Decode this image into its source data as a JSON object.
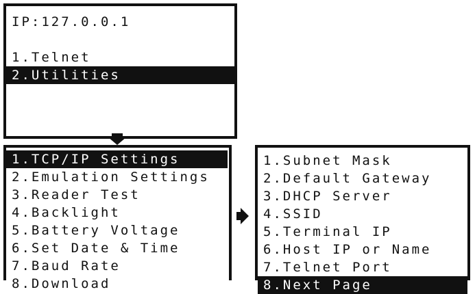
{
  "screen1": {
    "ip_label": "IP:127.0.0.1",
    "items": [
      "1.Telnet",
      "2.Utilities"
    ],
    "selected": "2.Utilities"
  },
  "screen2": {
    "items": [
      "1.TCP/IP Settings",
      "2.Emulation Settings",
      "3.Reader Test",
      "4.Backlight",
      "5.Battery Voltage",
      "6.Set Date & Time",
      "7.Baud Rate",
      "8.Download"
    ],
    "selected": "1.TCP/IP Settings"
  },
  "screen3": {
    "items": [
      "1.Subnet Mask",
      "2.Default Gateway",
      "3.DHCP Server",
      "4.SSID",
      "5.Terminal IP",
      "6.Host IP or Name",
      "7.Telnet Port",
      "8.Next Page"
    ],
    "selected": "8.Next Page"
  },
  "icons": [
    "arrow-down-icon",
    "arrow-right-icon"
  ]
}
